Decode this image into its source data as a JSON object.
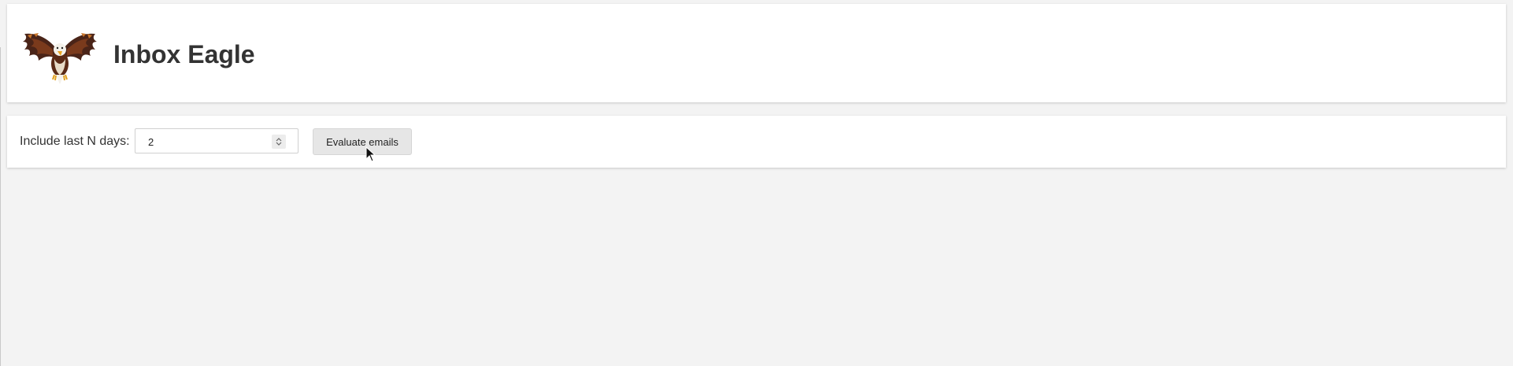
{
  "header": {
    "logo_icon": "eagle-logo-icon",
    "title": "Inbox Eagle"
  },
  "controls": {
    "days_label": "Include last N days:",
    "days_value": "2",
    "evaluate_button": "Evaluate emails"
  },
  "colors": {
    "background": "#f3f3f3",
    "card": "#ffffff",
    "button": "#e6e6e6",
    "text": "#333333"
  }
}
